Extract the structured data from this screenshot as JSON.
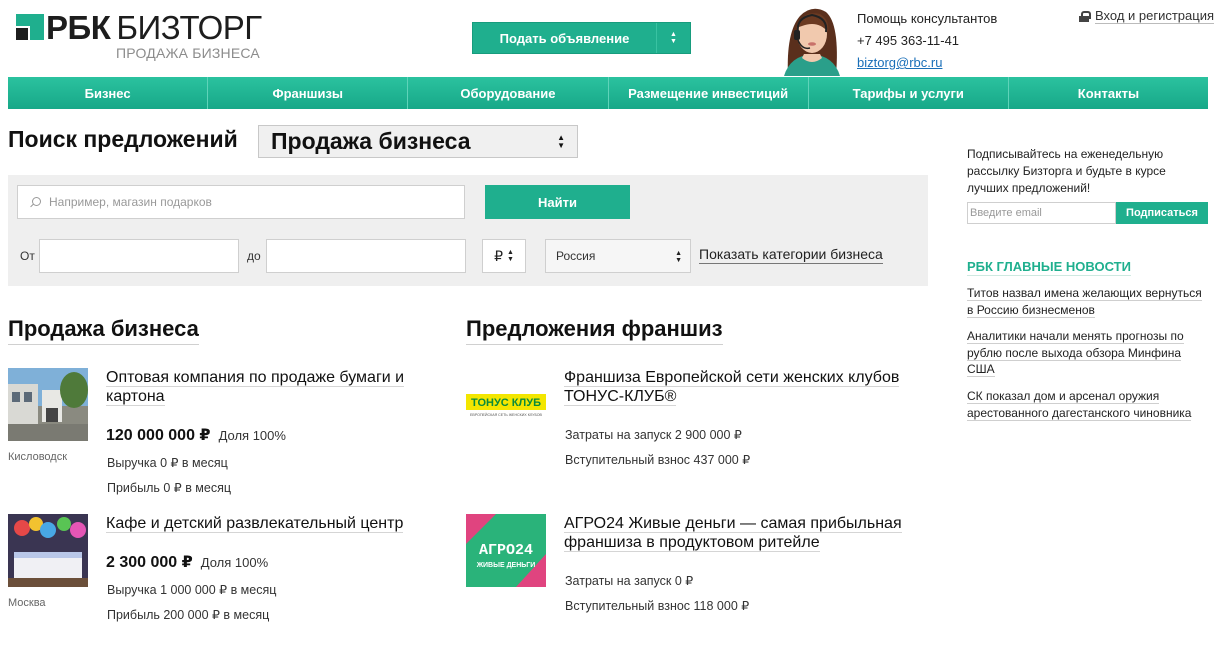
{
  "header": {
    "logo_rbc": "РБК",
    "logo_biz": "БИЗТОРГ",
    "logo_sub": "ПРОДАЖА БИЗНЕСА",
    "post_button": "Подать объявление",
    "help_title": "Помощь консультантов",
    "help_phone": "+7 495 363-11-41",
    "help_email": "biztorg@rbc.ru",
    "login": "Вход и регистрация",
    "accent_color": "#1faf8e"
  },
  "nav": {
    "items": [
      {
        "label": "Бизнес"
      },
      {
        "label": "Франшизы"
      },
      {
        "label": "Оборудование"
      },
      {
        "label": "Размещение инвестиций"
      },
      {
        "label": "Тарифы и услуги"
      },
      {
        "label": "Контакты"
      }
    ]
  },
  "search": {
    "title": "Поиск предложений",
    "category": "Продажа бизнеса",
    "placeholder": "Например, магазин подарков",
    "find_button": "Найти",
    "from_label": "От",
    "to_label": "до",
    "currency": "₽",
    "region": "Россия",
    "show_categories": "Показать категории бизнеса"
  },
  "business": {
    "title": "Продажа бизнеса",
    "items": [
      {
        "title": "Оптовая компания по продаже бумаги и картона",
        "city": "Кисловодск",
        "price": "120 000 000 ₽",
        "share": "Доля 100%",
        "revenue": "Выручка 0 ₽ в месяц",
        "profit": "Прибыль 0 ₽ в месяц"
      },
      {
        "title": "Кафе и детский развлекательный центр",
        "city": "Москва",
        "price": "2 300 000 ₽",
        "share": "Доля 100%",
        "revenue": "Выручка 1 000 000 ₽ в месяц",
        "profit": "Прибыль 200 000 ₽ в месяц"
      }
    ]
  },
  "franchise": {
    "title": "Предложения франшиз",
    "items": [
      {
        "title": "Франшиза Европейской сети женских клубов ТОНУС-КЛУБ®",
        "logo_text": "ТОНУС КЛУБ",
        "logo_sub": "ЕВРОПЕЙСКАЯ СЕТЬ ЖЕНСКИХ КЛУБОВ",
        "launch": "Затраты на запуск 2 900 000 ₽",
        "fee": "Вступительный взнос 437 000 ₽"
      },
      {
        "title": "АГРО24 Живые деньги — самая прибыльная франшиза в продуктовом ритейле",
        "logo_text": "АГРО24",
        "logo_sub": "ЖИВЫЕ ДЕНЬГИ",
        "launch": "Затраты на запуск 0 ₽",
        "fee": "Вступительный взнос 118 000 ₽"
      }
    ]
  },
  "sidebar": {
    "subscribe_text": "Подписывайтесь на еженедельную рассылку Бизторга и будьте в курсе лучших предложений!",
    "email_placeholder": "Введите email",
    "subscribe_button": "Подписаться",
    "news_title": "РБК ГЛАВНЫЕ НОВОСТИ",
    "news": [
      {
        "text": "Титов назвал имена желающих вернуться в Россию бизнесменов"
      },
      {
        "text": "Аналитики начали менять прогнозы по рублю после выхода обзора Минфина США"
      },
      {
        "text": "СК показал дом и арсенал оружия арестованного дагестанского чиновника"
      }
    ]
  }
}
